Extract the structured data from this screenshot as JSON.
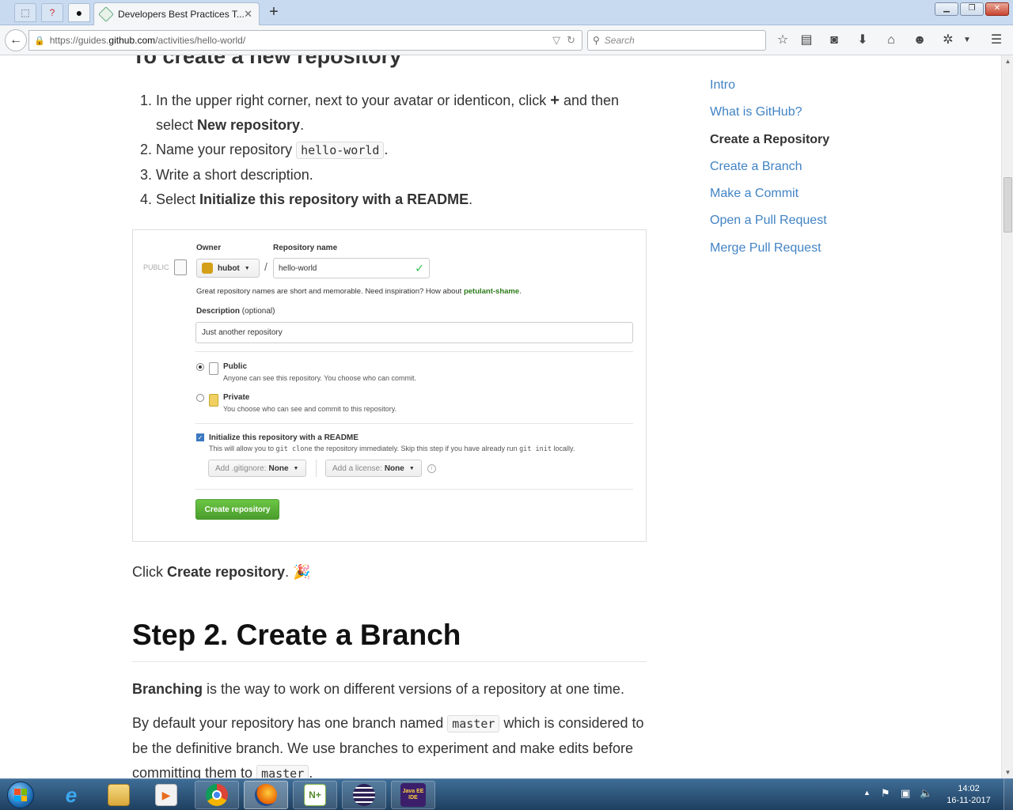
{
  "browser": {
    "tab_title": "Developers Best Practices T...",
    "url_prefix": "https://guides.",
    "url_domain": "github.com",
    "url_path": "/activities/hello-world/",
    "search_placeholder": "Search"
  },
  "article": {
    "section_heading": "To create a new repository",
    "steps": [
      {
        "before": "In the upper right corner, next to your avatar or identicon, click ",
        "plus": "+",
        "after": " and then select ",
        "bold": "New repository",
        "end": "."
      },
      {
        "before": "Name your repository ",
        "code": "hello-world",
        "end": "."
      },
      {
        "text": "Write a short description."
      },
      {
        "before": "Select ",
        "bold": "Initialize this repository with a README",
        "end": "."
      }
    ],
    "form": {
      "owner_label": "Owner",
      "repo_label": "Repository name",
      "public_tag": "PUBLIC",
      "owner_value": "hubot",
      "repo_value": "hello-world",
      "hint_text": "Great repository names are short and memorable. Need inspiration? How about ",
      "hint_suggestion": "petulant-shame",
      "hint_end": ".",
      "description_label": "Description",
      "description_optional": "(optional)",
      "description_value": "Just another repository",
      "public_title": "Public",
      "public_desc": "Anyone can see this repository. You choose who can commit.",
      "private_title": "Private",
      "private_desc": "You choose who can see and commit to this repository.",
      "init_title": "Initialize this repository with a README",
      "init_desc_1": "This will allow you to ",
      "init_code_1": "git clone",
      "init_desc_2": " the repository immediately. Skip this step if you have already run ",
      "init_code_2": "git init",
      "init_desc_3": " locally.",
      "gitignore_label": "Add .gitignore:",
      "gitignore_value": "None",
      "license_label": "Add a license:",
      "license_value": "None",
      "create_button": "Create repository"
    },
    "click_prefix": "Click ",
    "click_bold": "Create repository",
    "click_end": ". 🎉",
    "step2_heading": "Step 2. Create a Branch",
    "p1_bold": "Branching",
    "p1_rest": " is the way to work on different versions of a repository at one time.",
    "p2_a": "By default your repository has one branch named ",
    "p2_code": "master",
    "p2_b": " which is considered to be the definitive branch. We use branches to experiment and make edits before committing them to ",
    "p2_code2": "master",
    "p2_c": "."
  },
  "toc": [
    {
      "label": "Intro",
      "current": false
    },
    {
      "label": "What is GitHub?",
      "current": false
    },
    {
      "label": "Create a Repository",
      "current": true
    },
    {
      "label": "Create a Branch",
      "current": false
    },
    {
      "label": "Make a Commit",
      "current": false
    },
    {
      "label": "Open a Pull Request",
      "current": false
    },
    {
      "label": "Merge Pull Request",
      "current": false
    }
  ],
  "taskbar": {
    "apps": [
      "internet-explorer-icon",
      "file-explorer-icon",
      "media-player-icon",
      "chrome-icon",
      "firefox-icon",
      "notepad-plus-icon",
      "eclipse-icon",
      "java-ee-ide-icon"
    ],
    "java_label": "Java EE IDE",
    "time": "14:02",
    "date": "16-11-2017"
  },
  "colors": {
    "link": "#4183c4",
    "create_button": "#6cc644",
    "taskbar": "#1e3f60"
  }
}
